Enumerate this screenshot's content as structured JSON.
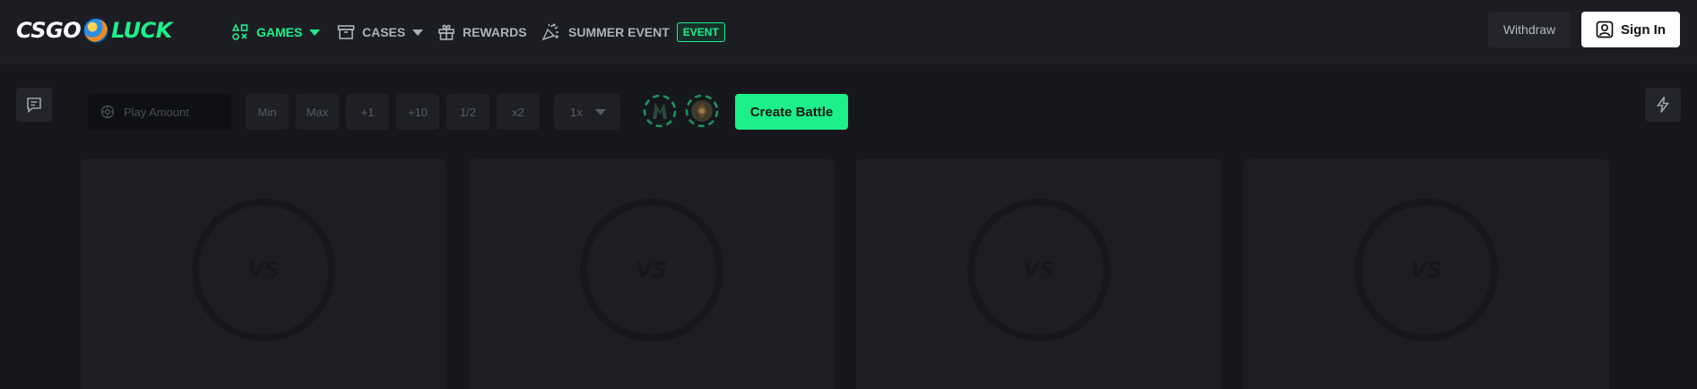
{
  "logo": {
    "left": "CSGO",
    "right": "LUCK"
  },
  "nav": {
    "games": "GAMES",
    "cases": "CASES",
    "rewards": "REWARDS",
    "summer_event": "SUMMER EVENT",
    "event_badge": "EVENT"
  },
  "header": {
    "withdraw": "Withdraw",
    "sign_in": "Sign In"
  },
  "controls": {
    "amount_placeholder": "Play Amount",
    "min": "Min",
    "max": "Max",
    "plus1": "+1",
    "plus10": "+10",
    "half": "1/2",
    "double": "x2",
    "multiplier": "1x",
    "create_battle": "Create Battle"
  },
  "cards": [
    {
      "vs": "VS"
    },
    {
      "vs": "VS"
    },
    {
      "vs": "VS"
    },
    {
      "vs": "VS"
    }
  ],
  "colors": {
    "accent": "#1cf08b",
    "background": "#16171c",
    "header": "#1c1d23",
    "card": "#1d1e24"
  },
  "icons": [
    "games-icon",
    "cases-icon",
    "rewards-icon",
    "summer-event-icon",
    "user-icon",
    "chat-icon",
    "lightning-icon",
    "coin-icon",
    "mode-icon-ct",
    "mode-icon-t"
  ]
}
